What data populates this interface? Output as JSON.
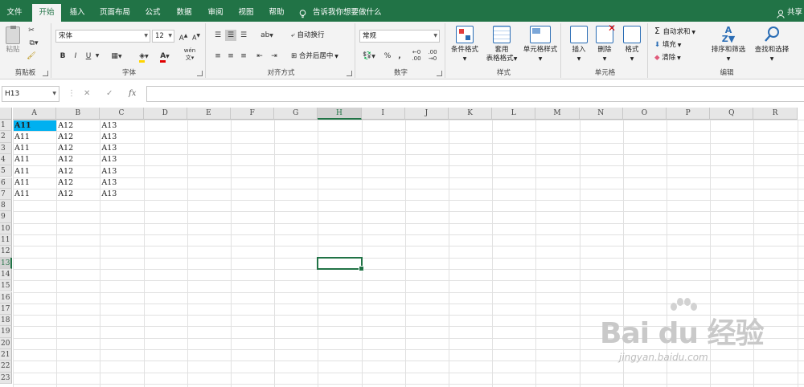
{
  "tabs": {
    "file": "文件",
    "home": "开始",
    "insert": "插入",
    "page_layout": "页面布局",
    "formulas": "公式",
    "data": "数据",
    "review": "审阅",
    "view": "视图",
    "help": "帮助",
    "tell_me": "告诉我你想要做什么",
    "share": "共享"
  },
  "ribbon": {
    "clipboard": {
      "paste": "粘贴",
      "label": "剪贴板"
    },
    "font": {
      "name": "宋体",
      "size": "12",
      "bold": "B",
      "italic": "I",
      "underline": "U",
      "phonetic": "wén",
      "label": "字体"
    },
    "alignment": {
      "wrap": "自动换行",
      "merge": "合并后居中",
      "label": "对齐方式"
    },
    "number": {
      "format": "常规",
      "percent": "%",
      "comma": ",",
      "label": "数字"
    },
    "styles": {
      "conditional": "条件格式",
      "table_line1": "套用",
      "table_line2": "表格格式",
      "cell_styles": "单元格样式",
      "label": "样式"
    },
    "cells": {
      "insert": "插入",
      "delete": "删除",
      "format": "格式",
      "label": "单元格"
    },
    "editing": {
      "autosum": "自动求和",
      "fill": "填充",
      "clear": "清除",
      "sort_filter": "排序和筛选",
      "find_select": "查找和选择",
      "label": "编辑"
    }
  },
  "formula_bar": {
    "name_box": "H13",
    "fx": "fx",
    "formula": ""
  },
  "sheet": {
    "columns": [
      "A",
      "B",
      "C",
      "D",
      "E",
      "F",
      "G",
      "H",
      "I",
      "J",
      "K",
      "L",
      "M",
      "N",
      "O",
      "P",
      "Q",
      "R"
    ],
    "rows": [
      "1",
      "2",
      "3",
      "4",
      "5",
      "6",
      "7",
      "8",
      "9",
      "10",
      "11",
      "12",
      "13",
      "14",
      "15",
      "16",
      "17",
      "18",
      "19",
      "20",
      "21",
      "22",
      "23"
    ],
    "selected_cell": "H13",
    "data": [
      [
        "A11",
        "A12",
        "A13"
      ],
      [
        "A11",
        "A12",
        "A13"
      ],
      [
        "A11",
        "A12",
        "A13"
      ],
      [
        "A11",
        "A12",
        "A13"
      ],
      [
        "A11",
        "A12",
        "A13"
      ],
      [
        "A11",
        "A12",
        "A13"
      ],
      [
        "A11",
        "A12",
        "A13"
      ]
    ],
    "highlight_color": "#00b0f0"
  },
  "watermark": {
    "main": "Bai du 经验",
    "sub": "jingyan.baidu.com"
  },
  "colors": {
    "accent": "#217346",
    "ribbon_bg": "#f3f3f3"
  }
}
